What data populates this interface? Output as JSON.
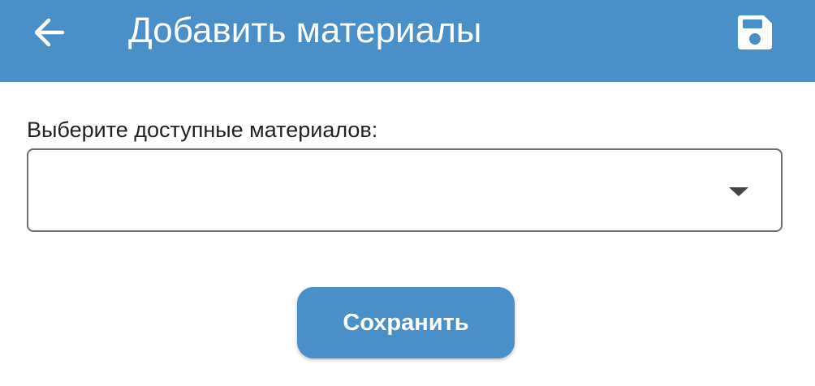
{
  "header": {
    "title": "Добавить материалы",
    "back_icon": "arrow-left-icon",
    "save_icon": "floppy-disk-icon",
    "background_color": "#4a8fc7"
  },
  "form": {
    "materials_label": "Выберите доступные материалов:",
    "materials_select_value": "",
    "dropdown_icon": "caret-down-icon"
  },
  "actions": {
    "save_label": "Сохранить",
    "button_color": "#4a8fc7"
  }
}
